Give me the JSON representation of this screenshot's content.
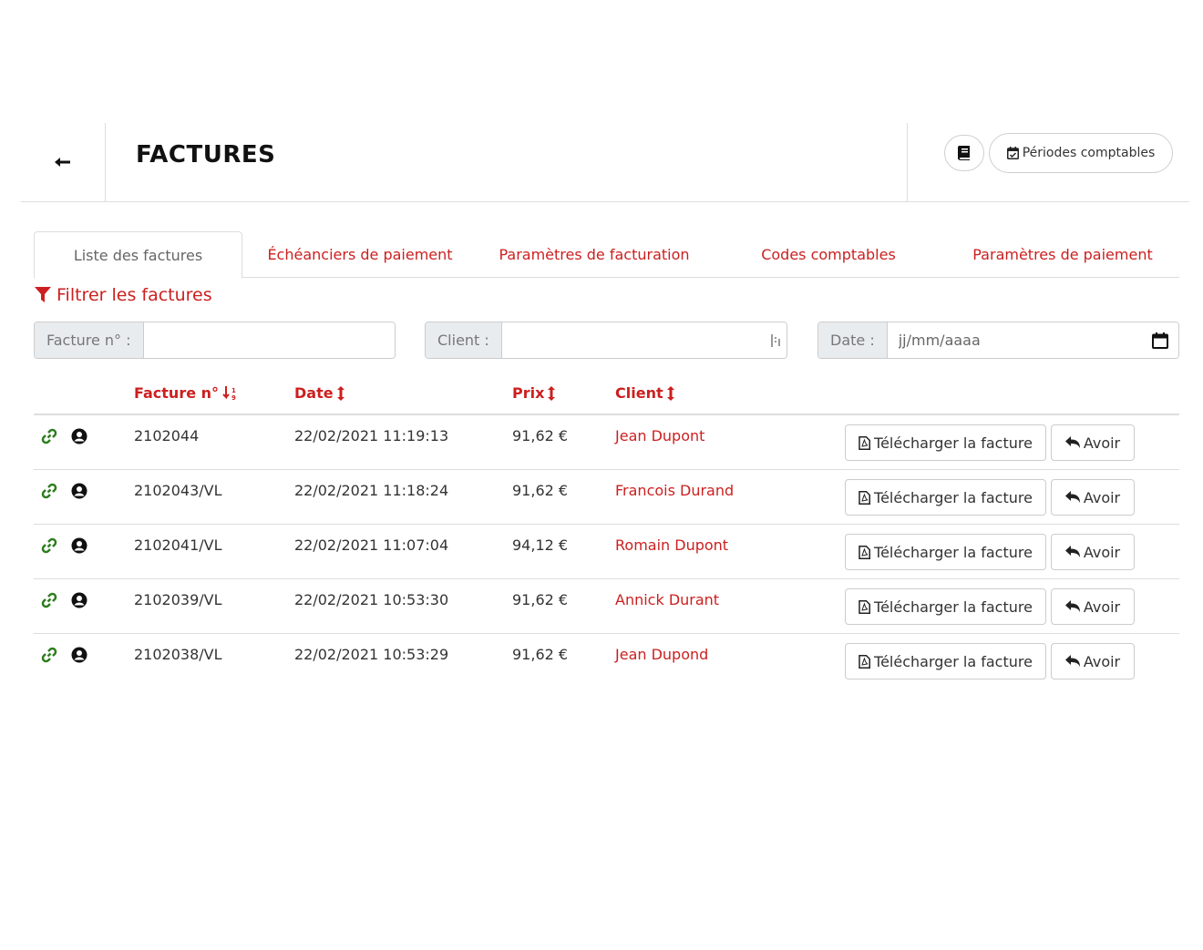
{
  "header": {
    "title": "FACTURES",
    "periods_label": "Périodes comptables"
  },
  "tabs": [
    {
      "label": "Liste des factures",
      "active": true
    },
    {
      "label": "Échéanciers de paiement",
      "active": false
    },
    {
      "label": "Paramètres de facturation",
      "active": false
    },
    {
      "label": "Codes comptables",
      "active": false
    },
    {
      "label": "Paramètres de paiement",
      "active": false
    }
  ],
  "filters": {
    "title": "Filtrer les factures",
    "invoice_label": "Facture n° :",
    "invoice_value": "",
    "client_label": "Client :",
    "client_value": "",
    "date_label": "Date :",
    "date_placeholder": "jj/mm/aaaa"
  },
  "table": {
    "columns": {
      "invoice": "Facture n°",
      "date": "Date",
      "price": "Prix",
      "client": "Client"
    },
    "download_label": "Télécharger la facture",
    "credit_label": "Avoir",
    "rows": [
      {
        "invoice": "2102044",
        "date": "22/02/2021 11:19:13",
        "price": "91,62 €",
        "client": "Jean Dupont"
      },
      {
        "invoice": "2102043/VL",
        "date": "22/02/2021 11:18:24",
        "price": "91,62 €",
        "client": "Francois Durand"
      },
      {
        "invoice": "2102041/VL",
        "date": "22/02/2021 11:07:04",
        "price": "94,12 €",
        "client": "Romain Dupont"
      },
      {
        "invoice": "2102039/VL",
        "date": "22/02/2021 10:53:30",
        "price": "91,62 €",
        "client": "Annick Durant"
      },
      {
        "invoice": "2102038/VL",
        "date": "22/02/2021 10:53:29",
        "price": "91,62 €",
        "client": "Jean Dupond"
      }
    ]
  },
  "colors": {
    "accent": "#cc1f1f",
    "link_icon": "#2e7d1e",
    "border": "#dddddd",
    "label_bg": "#e9ecef"
  }
}
